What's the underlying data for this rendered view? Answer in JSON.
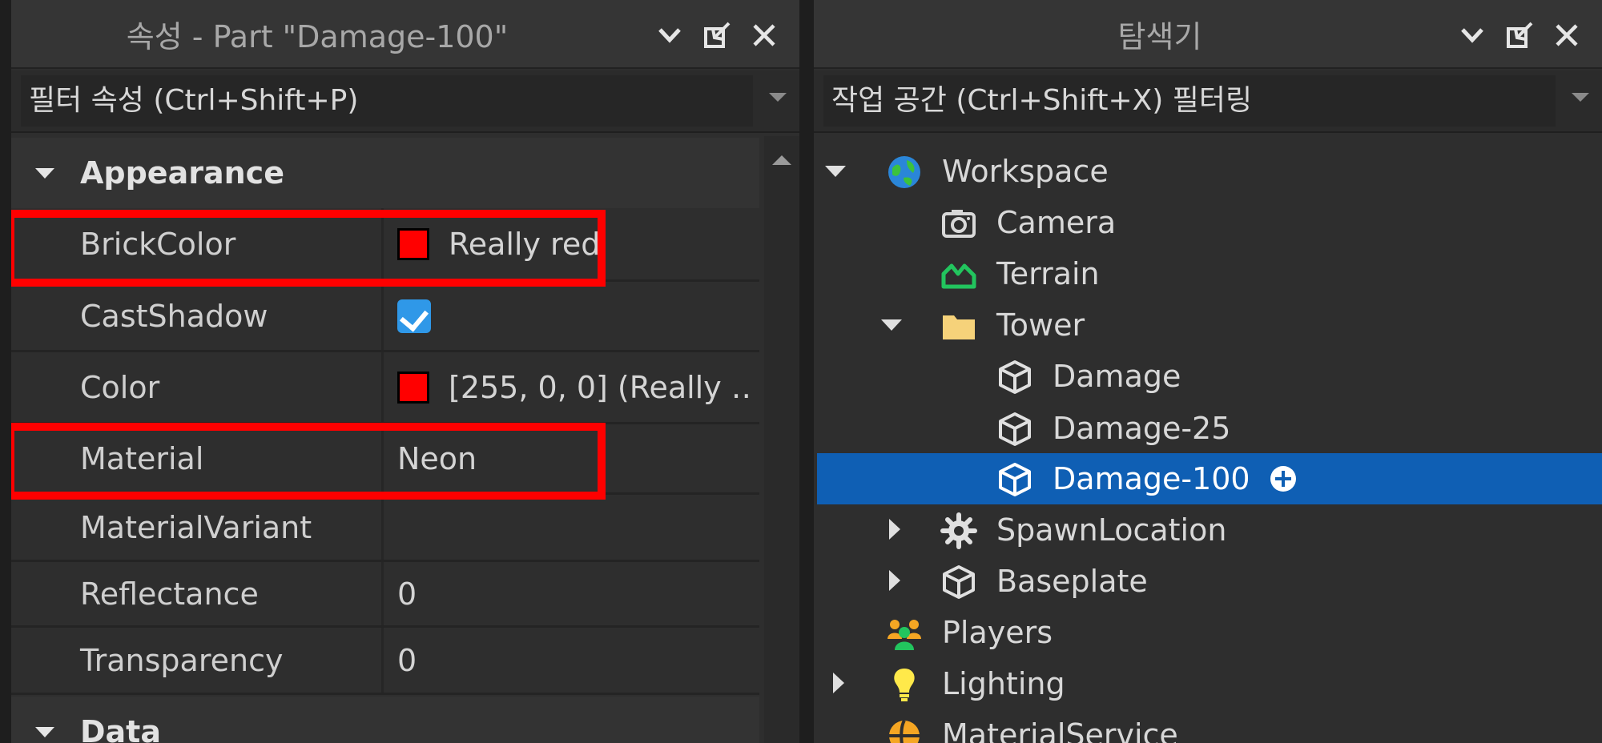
{
  "properties_panel": {
    "title": "속성 - Part \"Damage-100\"",
    "filter_placeholder": "필터 속성 (Ctrl+Shift+P)",
    "sections": [
      {
        "label": "Appearance",
        "rows": [
          {
            "name": "BrickColor",
            "value": "Really red",
            "swatch": "#ff0000",
            "highlighted": true
          },
          {
            "name": "CastShadow",
            "value": "",
            "checked": true
          },
          {
            "name": "Color",
            "value": "[255, 0, 0] (Really …",
            "swatch": "#ff0000"
          },
          {
            "name": "Material",
            "value": "Neon",
            "highlighted": true
          },
          {
            "name": "MaterialVariant",
            "value": ""
          },
          {
            "name": "Reflectance",
            "value": "0"
          },
          {
            "name": "Transparency",
            "value": "0"
          }
        ]
      },
      {
        "label": "Data",
        "rows": []
      }
    ],
    "highlight_color": "#ff0000"
  },
  "explorer_panel": {
    "title": "탐색기",
    "filter_placeholder": "작업 공간 (Ctrl+Shift+X) 필터링",
    "tree": [
      {
        "label": "Workspace",
        "icon": "globe-icon",
        "expanded": true
      },
      {
        "label": "Camera",
        "icon": "camera-icon"
      },
      {
        "label": "Terrain",
        "icon": "terrain-icon"
      },
      {
        "label": "Tower",
        "icon": "folder-icon",
        "expanded": true
      },
      {
        "label": "Damage",
        "icon": "part-cube-icon"
      },
      {
        "label": "Damage-25",
        "icon": "part-cube-icon"
      },
      {
        "label": "Damage-100",
        "icon": "part-cube-icon",
        "selected": true
      },
      {
        "label": "SpawnLocation",
        "icon": "spawn-gear-icon",
        "expanded": false
      },
      {
        "label": "Baseplate",
        "icon": "part-cube-icon",
        "expanded": false
      },
      {
        "label": "Players",
        "icon": "players-icon"
      },
      {
        "label": "Lighting",
        "icon": "lightbulb-icon",
        "expanded": false
      },
      {
        "label": "MaterialService",
        "icon": "material-service-icon"
      }
    ],
    "selection_color": "#0f5fb4"
  }
}
